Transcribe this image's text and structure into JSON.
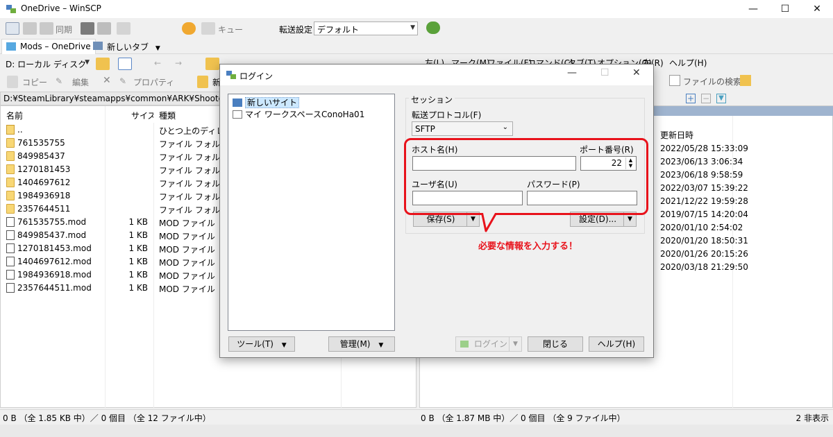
{
  "window": {
    "title": "OneDrive – WinSCP",
    "minimize": "—",
    "maximize": "☐",
    "close": "✕"
  },
  "toolbar1": {
    "sync_label": "同期",
    "queue_label": "キュー",
    "transfer_settings_label": "転送設定",
    "transfer_settings_value": "デフォルト"
  },
  "tabs": [
    {
      "label": "Mods – OneDrive"
    },
    {
      "label": "新しいタブ"
    }
  ],
  "left_toolbar": {
    "drive_label": "D: ローカル ディスク"
  },
  "left_actions": {
    "copy": "コピー",
    "edit": "編集",
    "properties": "プロパティ",
    "new": "新"
  },
  "right_menu": {
    "items": [
      "左(L)",
      "マーク(M)",
      "ファイル(F)",
      "コマンド(C)",
      "タブ(T)",
      "オプション(O)",
      "右(R)",
      "ヘルプ(H)"
    ]
  },
  "right_actions": {
    "find_files": "ファイルの検索"
  },
  "left_path": "D:¥SteamLibrary¥steamapps¥common¥ARK¥ShooterGame¥",
  "left_columns": {
    "name": "名前",
    "size": "サイズ",
    "type": "種類"
  },
  "left_files": [
    {
      "name": "..",
      "size": "",
      "type": "ひとつ上のディレクトリ",
      "kind": "up"
    },
    {
      "name": "761535755",
      "size": "",
      "type": "ファイル フォルダー",
      "kind": "folder"
    },
    {
      "name": "849985437",
      "size": "",
      "type": "ファイル フォルダー",
      "kind": "folder"
    },
    {
      "name": "1270181453",
      "size": "",
      "type": "ファイル フォルダー",
      "kind": "folder"
    },
    {
      "name": "1404697612",
      "size": "",
      "type": "ファイル フォルダー",
      "kind": "folder"
    },
    {
      "name": "1984936918",
      "size": "",
      "type": "ファイル フォルダー",
      "kind": "folder"
    },
    {
      "name": "2357644511",
      "size": "",
      "type": "ファイル フォルダー",
      "kind": "folder"
    },
    {
      "name": "761535755.mod",
      "size": "1 KB",
      "type": "MOD ファイル",
      "kind": "mod"
    },
    {
      "name": "849985437.mod",
      "size": "1 KB",
      "type": "MOD ファイル",
      "kind": "mod"
    },
    {
      "name": "1270181453.mod",
      "size": "1 KB",
      "type": "MOD ファイル",
      "kind": "mod"
    },
    {
      "name": "1404697612.mod",
      "size": "1 KB",
      "type": "MOD ファイル",
      "kind": "mod"
    },
    {
      "name": "1984936918.mod",
      "size": "1 KB",
      "type": "MOD ファイル",
      "kind": "mod"
    },
    {
      "name": "2357644511.mod",
      "size": "1 KB",
      "type": "MOD ファイル",
      "kind": "mod"
    }
  ],
  "right_columns": {
    "modified": "更新日時"
  },
  "right_dates": [
    "2022/05/28 15:33:09",
    "2023/06/13 3:06:34",
    "2023/06/18 9:58:59",
    "2022/03/07 15:39:22",
    "2021/12/22 19:59:28",
    "2019/07/15 14:20:04",
    "2020/01/10 2:54:02",
    "2020/01/20 18:50:31",
    "2020/01/26 20:15:26",
    "2020/03/18 21:29:50"
  ],
  "status": {
    "left": "0 B （全 1.85 KB 中）／ 0 個目 （全 12 ファイル中）",
    "right": "0 B （全 1.87 MB 中）／ 0 個目 （全 9 ファイル中）",
    "hidden": "2 非表示"
  },
  "dialog": {
    "title": "ログイン",
    "sites": [
      {
        "label": "新しいサイト"
      },
      {
        "label": "マイ ワークスペースConoHa01"
      }
    ],
    "tools_button": "ツール(T)",
    "manage_button": "管理(M)",
    "session_label": "セッション",
    "protocol_label": "転送プロトコル(F)",
    "protocol_value": "SFTP",
    "host_label": "ホスト名(H)",
    "host_value": "",
    "port_label": "ポート番号(R)",
    "port_value": "22",
    "user_label": "ユーザ名(U)",
    "user_value": "",
    "password_label": "パスワード(P)",
    "password_value": "",
    "save_button": "保存(S)",
    "advanced_button": "設定(D)...",
    "login_button": "ログイン",
    "close_button": "閉じる",
    "help_button": "ヘルプ(H)"
  },
  "annotation": {
    "callout": "必要な情報を入力する！",
    "color": "#e8121b"
  }
}
